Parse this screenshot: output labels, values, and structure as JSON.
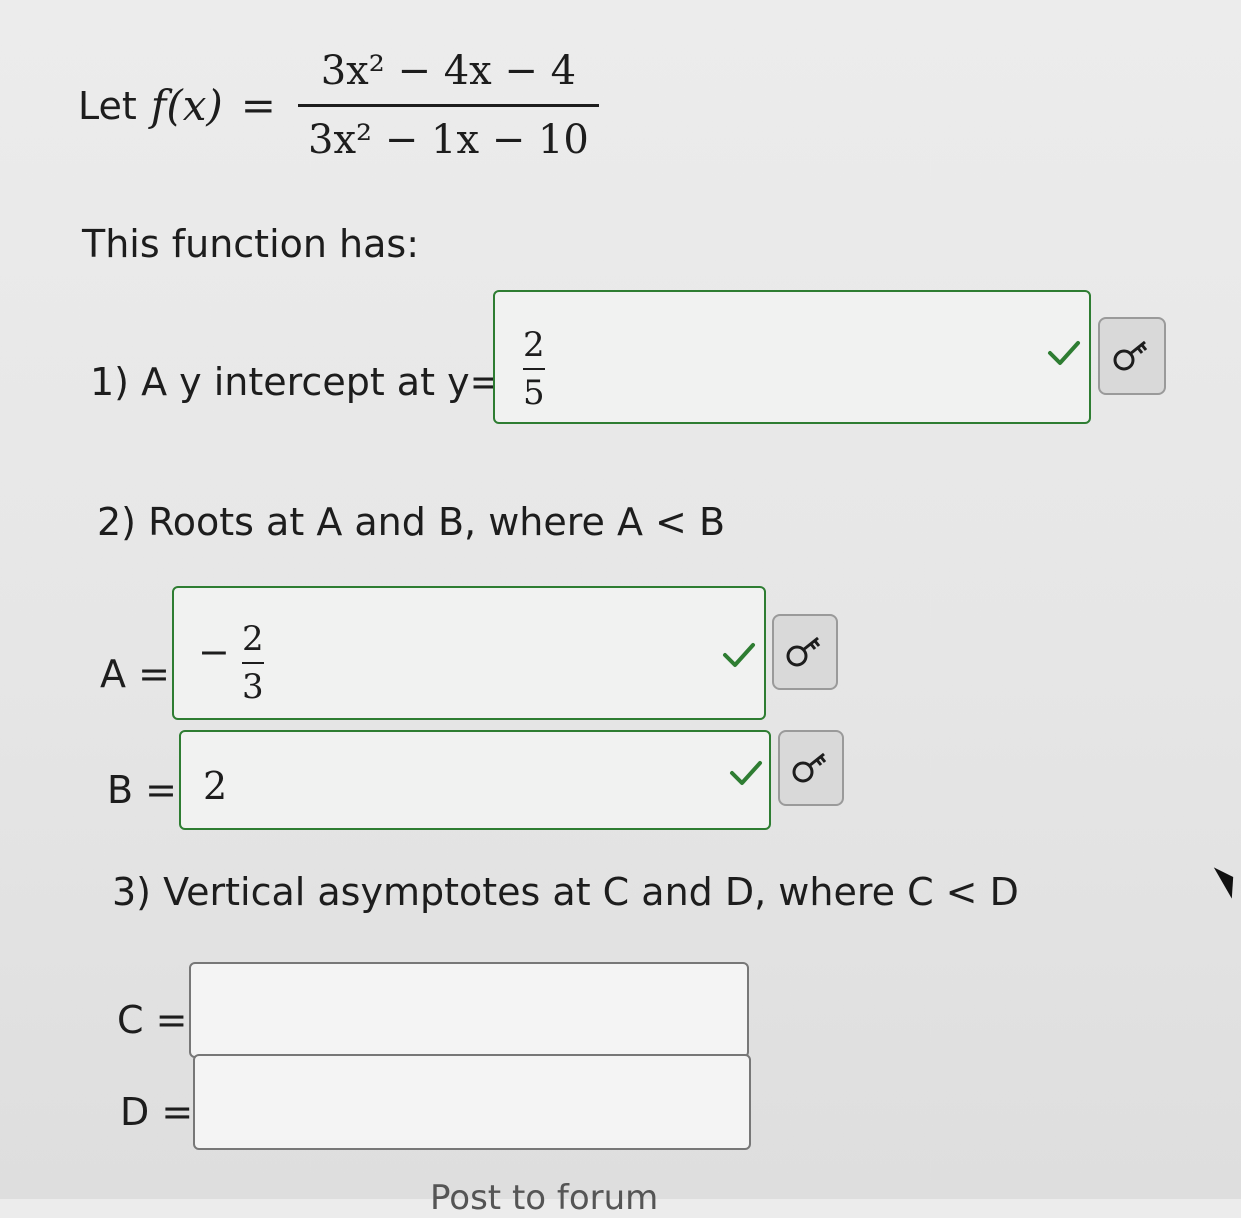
{
  "problem": {
    "let_word": "Let",
    "function_name": "f(x)",
    "equals": "=",
    "numerator": "3x² − 4x − 4",
    "denominator": "3x² − 1x − 10"
  },
  "intro": "This function has:",
  "q1": {
    "label": "1) A y intercept at y=",
    "answer": {
      "numerator": "2",
      "denominator": "5"
    },
    "status": "correct"
  },
  "q2": {
    "label": "2) Roots at A and B, where A < B",
    "a_label": "A =",
    "a_answer": {
      "sign": "−",
      "numerator": "2",
      "denominator": "3"
    },
    "b_label": "B =",
    "b_answer": "2",
    "status": "correct"
  },
  "q3": {
    "label": "3) Vertical asymptotes at C and D, where C < D",
    "c_label": "C =",
    "c_value": "",
    "d_label": "D =",
    "d_value": ""
  },
  "footer": {
    "forum_link": "Post to forum"
  },
  "colors": {
    "correct_border": "#2e7d32",
    "check": "#2e7d32",
    "empty_border": "#777777"
  },
  "icons": [
    "checkmark-icon",
    "key-icon"
  ]
}
